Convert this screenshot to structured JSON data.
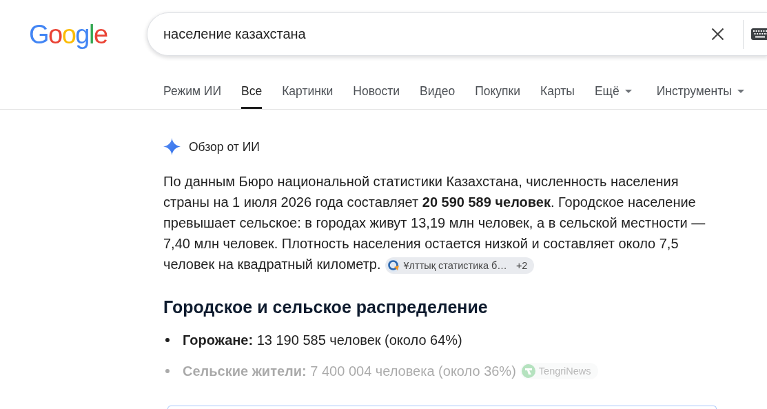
{
  "logo": {
    "text": "Google"
  },
  "search": {
    "value": "население казахстана"
  },
  "tabs": [
    {
      "label": "Режим ИИ",
      "selected": false,
      "menu": false
    },
    {
      "label": "Все",
      "selected": true,
      "menu": false
    },
    {
      "label": "Картинки",
      "selected": false,
      "menu": false
    },
    {
      "label": "Новости",
      "selected": false,
      "menu": false
    },
    {
      "label": "Видео",
      "selected": false,
      "menu": false
    },
    {
      "label": "Покупки",
      "selected": false,
      "menu": false
    },
    {
      "label": "Карты",
      "selected": false,
      "menu": false
    },
    {
      "label": "Ещё",
      "selected": false,
      "menu": true
    }
  ],
  "tools": {
    "label": "Инструменты",
    "menu": true
  },
  "overview": {
    "title": "Обзор от ИИ",
    "paragraph": "По данным Бюро национальной статистики Казахстана, численность населения страны на 1 июля 2026 года составляет **20 590 589 человек**. Городское население превышает сельское: в городах живут 13,19 млн человек, а в сельской местности — 7,40 млн человек. Плотность населения остается низкой и составляет около 7,5 человек на квадратный километр.",
    "citation": {
      "source": "Ұлттық статистика б…",
      "more": "+2"
    }
  },
  "section": {
    "heading": "Городское и сельское распределение",
    "items": [
      {
        "text": "**Горожане:** 13 190 585 человек (около 64%)",
        "faded": false
      },
      {
        "text": "**Сельские жители:** 7 400 004 человека (около 36%)",
        "faded": true,
        "citation": {
          "source": "TengriNews"
        }
      }
    ]
  }
}
